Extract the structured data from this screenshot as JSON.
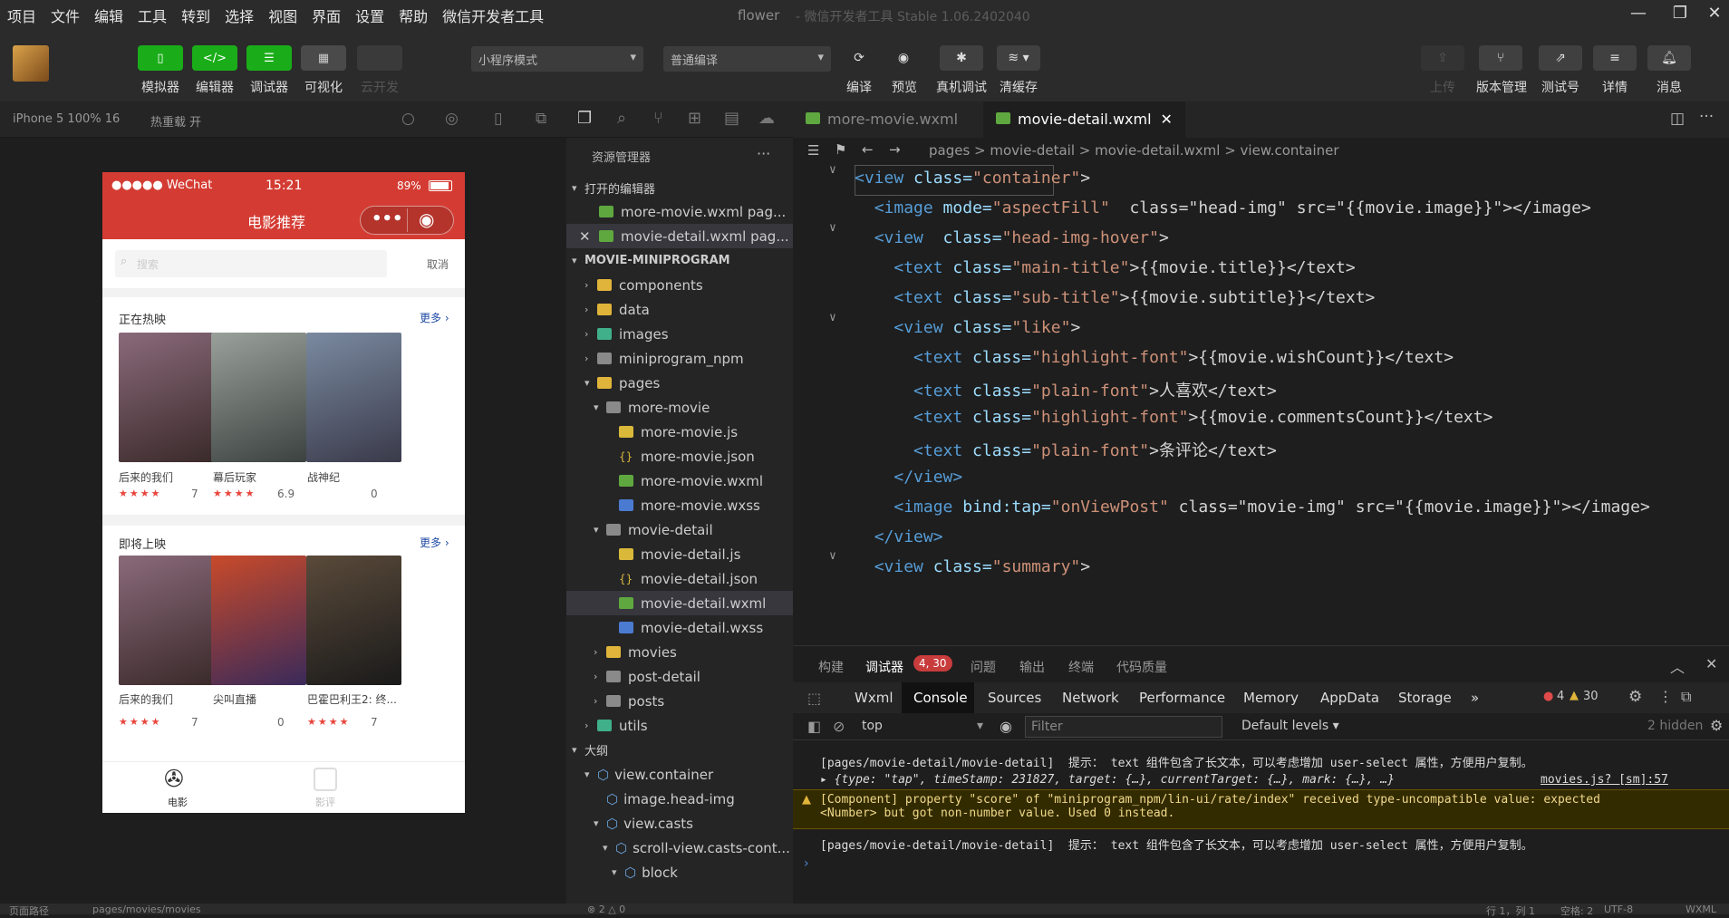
{
  "menu": [
    "项目",
    "文件",
    "编辑",
    "工具",
    "转到",
    "选择",
    "视图",
    "界面",
    "设置",
    "帮助",
    "微信开发者工具"
  ],
  "window_title": "flower",
  "window_subtitle": "- 微信开发者工具 Stable 1.06.2402040",
  "toolbar": {
    "simulator": "模拟器",
    "editor": "编辑器",
    "debugger": "调试器",
    "visual": "可视化",
    "cloud": "云开发",
    "mode": "小程序模式",
    "compile_mode": "普通编译",
    "compile": "编译",
    "preview": "预览",
    "real_debug": "真机调试",
    "clear_cache": "清缓存",
    "upload": "上传",
    "version": "版本管理",
    "test": "测试号",
    "detail": "详情",
    "message": "消息"
  },
  "device": {
    "model": "iPhone 5 100% 16",
    "hot_reload": "热重载 开"
  },
  "phone": {
    "signal": "●●●●● WeChat",
    "time": "15:21",
    "battery": "89%",
    "title": "电影推荐",
    "search_placeholder": "搜索",
    "cancel": "取消",
    "section1": {
      "title": "正在热映",
      "more": "更多 ›",
      "movies": [
        {
          "name": "后来的我们",
          "stars": "★★★★",
          "score": "7"
        },
        {
          "name": "幕后玩家",
          "stars": "★★★★",
          "score": "6.9"
        },
        {
          "name": "战神纪",
          "stars": "",
          "score": "0"
        }
      ]
    },
    "section2": {
      "title": "即将上映",
      "more": "更多 ›",
      "movies": [
        {
          "name": "后来的我们",
          "stars": "★★★★",
          "score": "7"
        },
        {
          "name": "尖叫直播",
          "stars": "",
          "score": "0"
        },
        {
          "name": "巴霍巴利王2: 终...",
          "stars": "★★★★",
          "score": "7"
        }
      ]
    },
    "tab_movie": "电影",
    "tab_cinema": "影评"
  },
  "explorer": {
    "title": "资源管理器",
    "open_editors": "打开的编辑器",
    "open_files": [
      "more-movie.wxml pag...",
      "movie-detail.wxml pag..."
    ],
    "project": "MOVIE-MINIPROGRAM",
    "tree": [
      "components",
      "data",
      "images",
      "miniprogram_npm",
      "pages",
      "more-movie",
      "more-movie.js",
      "more-movie.json",
      "more-movie.wxml",
      "more-movie.wxss",
      "movie-detail",
      "movie-detail.js",
      "movie-detail.json",
      "movie-detail.wxml",
      "movie-detail.wxss",
      "movies",
      "post-detail",
      "posts",
      "utils"
    ],
    "outline": "大纲",
    "outline_items": [
      "view.container",
      "image.head-img",
      "view.casts",
      "scroll-view.casts-cont...",
      "block"
    ]
  },
  "editor": {
    "tab1": "more-movie.wxml",
    "tab2": "movie-detail.wxml",
    "crumb": "pages > movie-detail > movie-detail.wxml > view.container",
    "lines": [
      {
        "pre": "",
        "tag": "<view",
        "a1": " class=",
        "v1": "\"container\"",
        "post": ">"
      },
      {
        "pre": "  ",
        "tag": "<image",
        "a1": " mode=",
        "v1": "\"aspectFill\"",
        "post": "  class=\"head-img\" src=\"{{movie.image}}\"></image>"
      },
      {
        "pre": "  ",
        "tag": "<view",
        "a1": "  class=",
        "v1": "\"head-img-hover\"",
        "post": ">"
      },
      {
        "pre": "    ",
        "tag": "<text",
        "a1": " class=",
        "v1": "\"main-title\"",
        "post": ">{{movie.title}}</text>"
      },
      {
        "pre": "    ",
        "tag": "<text",
        "a1": " class=",
        "v1": "\"sub-title\"",
        "post": ">{{movie.subtitle}}</text>"
      },
      {
        "pre": "    ",
        "tag": "<view",
        "a1": " class=",
        "v1": "\"like\"",
        "post": ">"
      },
      {
        "pre": "      ",
        "tag": "<text",
        "a1": " class=",
        "v1": "\"highlight-font\"",
        "post": ">{{movie.wishCount}}</text>"
      },
      {
        "pre": "      ",
        "tag": "<text",
        "a1": " class=",
        "v1": "\"plain-font\"",
        "post": ">人喜欢</text>"
      },
      {
        "pre": "      ",
        "tag": "<text",
        "a1": " class=",
        "v1": "\"highlight-font\"",
        "post": ">{{movie.commentsCount}}</text>"
      },
      {
        "pre": "      ",
        "tag": "<text",
        "a1": " class=",
        "v1": "\"plain-font\"",
        "post": ">条评论</text>"
      },
      {
        "pre": "    ",
        "tag": "</view>",
        "a1": "",
        "v1": "",
        "post": ""
      },
      {
        "pre": "    ",
        "tag": "<image",
        "a1": " bind:tap=",
        "v1": "\"onViewPost\"",
        "post": " class=\"movie-img\" src=\"{{movie.image}}\"></image>"
      },
      {
        "pre": "  ",
        "tag": "</view>",
        "a1": "",
        "v1": "",
        "post": ""
      },
      {
        "pre": "  ",
        "tag": "<view",
        "a1": " class=",
        "v1": "\"summary\"",
        "post": ">"
      }
    ]
  },
  "devtools": {
    "tabs": [
      "构建",
      "调试器",
      "问题",
      "输出",
      "终端",
      "代码质量"
    ],
    "badge": "4, 30",
    "panels": [
      "Wxml",
      "Console",
      "Sources",
      "Network",
      "Performance",
      "Memory",
      "AppData",
      "Storage"
    ],
    "err_count": "4",
    "warn_count": "30",
    "context": "top",
    "filter": "Filter",
    "levels": "Default levels ▾",
    "hidden": "2 hidden",
    "logs": [
      "[pages/movie-detail/movie-detail]  提示： text 组件包含了长文本，可以考虑增加 user-select 属性，方便用户复制。",
      "▸ {type: \"tap\", timeStamp: 231827, target: {…}, currentTarget: {…}, mark: {…}, …}",
      "[Component] property \"score\" of \"miniprogram_npm/lin-ui/rate/index\" received type-uncompatible value: expected\n<Number> but got non-number value. Used 0 instead.",
      "[pages/movie-detail/movie-detail]  提示： text 组件包含了长文本，可以考虑增加 user-select 属性，方便用户复制。"
    ],
    "link": "movies.js? [sm]:57"
  },
  "status": {
    "path": "页面路径",
    "page": "pages/movies/movies",
    "errors": "⊗ 2 △ 0",
    "pos": "行 1，列 1",
    "spaces": "空格: 2",
    "enc": "UTF-8",
    "lang": "WXML"
  },
  "colors": {
    "accent_green": "#1aad19",
    "wechat_red": "#d43c33"
  }
}
